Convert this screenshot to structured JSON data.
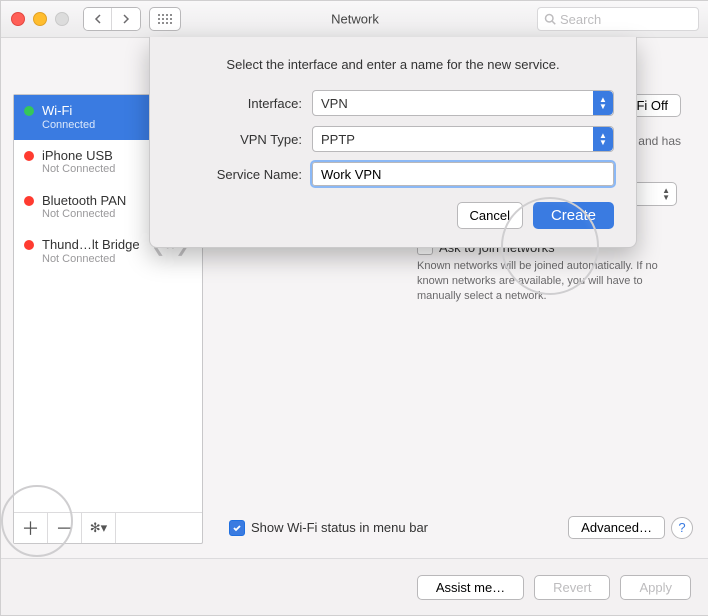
{
  "window": {
    "title": "Network"
  },
  "toolbar": {
    "search_placeholder": "Search"
  },
  "sidebar": {
    "services": [
      {
        "name": "Wi-Fi",
        "status": "Connected",
        "state": "green",
        "selected": true
      },
      {
        "name": "iPhone USB",
        "status": "Not Connected",
        "state": "red"
      },
      {
        "name": "Bluetooth PAN",
        "status": "Not Connected",
        "state": "red"
      },
      {
        "name": "Thund…lt Bridge",
        "status": "Not Connected",
        "state": "red",
        "draggable": true
      }
    ]
  },
  "main": {
    "wifi_toggle_label": "Turn Wi-Fi Off",
    "hint_fragment": "F and has",
    "ask_label": "Ask to join networks",
    "ask_help": "Known networks will be joined automatically. If no known networks are available, you will have to manually select a network.",
    "show_status_label": "Show Wi-Fi status in menu bar",
    "advanced_label": "Advanced…"
  },
  "actions": {
    "assist": "Assist me…",
    "revert": "Revert",
    "apply": "Apply"
  },
  "sheet": {
    "prompt": "Select the interface and enter a name for the new service.",
    "rows": {
      "interface_label": "Interface:",
      "interface_value": "VPN",
      "vpn_type_label": "VPN Type:",
      "vpn_type_value": "PPTP",
      "service_name_label": "Service Name:",
      "service_name_value": "Work VPN"
    },
    "cancel_label": "Cancel",
    "create_label": "Create"
  }
}
